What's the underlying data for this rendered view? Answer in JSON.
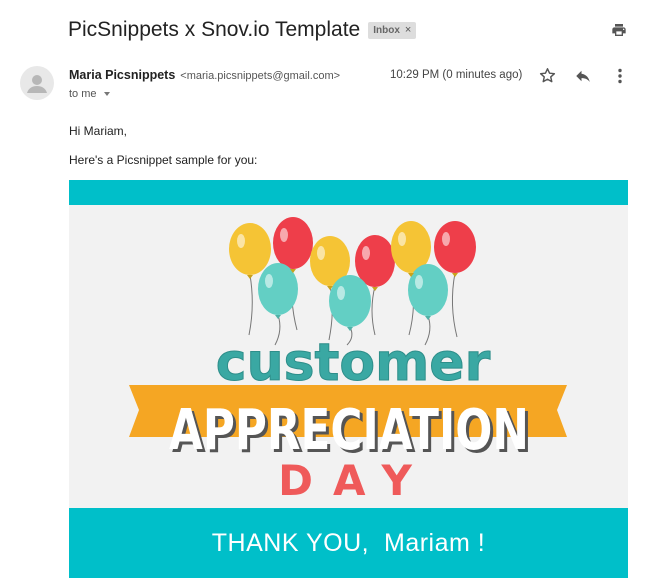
{
  "email": {
    "subject": "PicSnippets x Snov.io Template",
    "label": "Inbox",
    "label_remove": "×",
    "sender_name": "Maria Picsnippets",
    "sender_email": "<maria.picsnippets@gmail.com>",
    "to": "to me",
    "timestamp": "10:29 PM (0 minutes ago)",
    "greeting": "Hi Mariam,",
    "intro": "Here's a Picsnippet sample for you:"
  },
  "card": {
    "line1": "customer",
    "line2": "APPRECIATION",
    "line3": "DAY",
    "thanks": "THANK YOU,  Mariam !"
  },
  "colors": {
    "teal": "#00bfc9",
    "balloon_red": "#ee3e4a",
    "balloon_yellow": "#f5c435",
    "balloon_teal": "#63cfc4",
    "ribbon": "#f5a623",
    "day_red": "#ef5a5a",
    "word_teal": "#3aa8a3"
  },
  "icons": {
    "print": "print-icon",
    "star": "star-outline-icon",
    "reply": "reply-icon",
    "more": "more-vertical-icon",
    "avatar": "person-silhouette-icon"
  }
}
